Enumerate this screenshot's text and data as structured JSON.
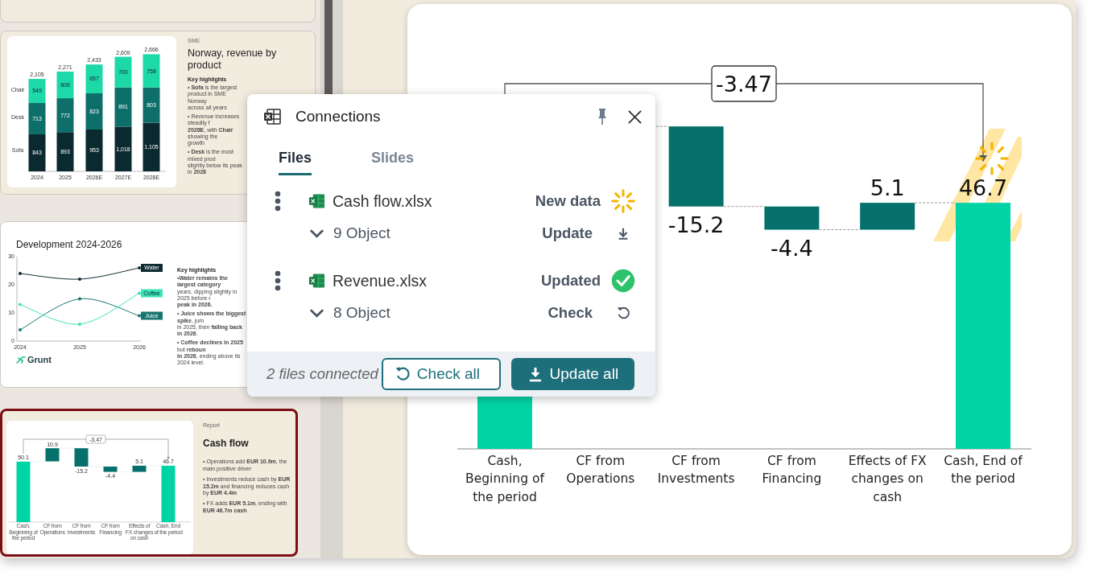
{
  "thumbnails": [
    {
      "kind": "stacked",
      "selected": false,
      "tag": "SME",
      "title": "Norway, revenue by product",
      "highlights_title": "Key highlights",
      "bullets": [
        {
          "lines": [
            "• **Sofa** is the largest product in SME Norway",
            "across all years"
          ]
        },
        {
          "lines": [
            "• Revenue increases steadily f",
            "**2028E**, with **Chair** showing the",
            "growth"
          ]
        },
        {
          "lines": [
            "• **Desk** is the most mixed prod",
            "slightly below its peak in **2028**"
          ]
        }
      ],
      "chart_data": {
        "type": "bar",
        "stacked": true,
        "data_labels": true,
        "categories": [
          "2024",
          "2025",
          "2026E",
          "2027E",
          "2028E"
        ],
        "series": [
          {
            "name": "Sofa",
            "color": "#0b2a2f",
            "values": [
              843,
              893,
              953,
              1018,
              1105
            ],
            "value_labels": [
              "843",
              "893",
              "953",
              "1,018",
              "1,105"
            ]
          },
          {
            "name": "Desk",
            "color": "#0e6e6a",
            "values": [
              713,
              772,
              823,
              891,
              803
            ],
            "value_labels": [
              "713",
              "772",
              "823",
              "891",
              "803"
            ]
          },
          {
            "name": "Chair",
            "color": "#1dd9a7",
            "values": [
              549,
              606,
              657,
              700,
              758
            ],
            "value_labels": [
              "549",
              "606",
              "657",
              "700",
              "758"
            ]
          }
        ],
        "annotations": [
          "2,105",
          "2,271",
          "2,433",
          "2,609",
          "2,666"
        ]
      }
    },
    {
      "kind": "line",
      "selected": false,
      "title": "Development 2024-2026",
      "highlights_title": "Key highlights",
      "bullets": [
        {
          "lines": [
            "•**Water remains the largest category**",
            "years, dipping slightly in 2025 before r",
            "**peak in 2026.**"
          ]
        },
        {
          "lines": [
            "• **Juice shows the biggest spike**, jum",
            "in 2025, then **falling back in 2026**."
          ]
        },
        {
          "lines": [
            "• **Coffee declines in 2025** but **reboun**",
            "**in 2026**, ending above its 2024 level."
          ]
        }
      ],
      "logo": "Grunt",
      "chart_data": {
        "type": "line",
        "x": [
          "2024",
          "2025",
          "2026"
        ],
        "ylim": [
          0,
          30
        ],
        "yticks": [
          0,
          10,
          20,
          30
        ],
        "series": [
          {
            "name": "Water",
            "color": "#0d2b30",
            "values": [
              24,
              22,
              26
            ]
          },
          {
            "name": "Juice",
            "color": "#16756e",
            "values": [
              4,
              15,
              9
            ]
          },
          {
            "name": "Coffee",
            "color": "#3de3b6",
            "values": [
              13,
              6,
              17
            ]
          }
        ]
      }
    },
    {
      "kind": "waterfall",
      "selected": true,
      "tag": "Report",
      "title": "Cash flow",
      "bullets": [
        {
          "text": "• Operations add **EUR 10.9m**, the main positive driver"
        },
        {
          "text": "• Investments reduce cash by **EUR 15.2m** and financing reduces cash by **EUR 4.4m**"
        },
        {
          "text": "• FX adds **EUR 5.1m**, ending with **EUR 46.7m cash**"
        }
      ],
      "waterfall": {
        "bracket": "-3.47",
        "bars": [
          {
            "label": "Cash, Beginning of the period",
            "value": "50.1",
            "kind": "total"
          },
          {
            "label": "CF from Operations",
            "value": "10.9",
            "kind": "delta"
          },
          {
            "label": "CF from Investments",
            "value": "-15.2",
            "kind": "delta"
          },
          {
            "label": "CF from Financing",
            "value": "-4.4",
            "kind": "delta"
          },
          {
            "label": "Effects of FX changes on cash",
            "value": "5.1",
            "kind": "delta"
          },
          {
            "label": "Cash, End of the period",
            "value": "46.7",
            "kind": "total"
          }
        ]
      }
    }
  ],
  "main_slide": {
    "new_data": true,
    "waterfall": {
      "bracket": "-3.47",
      "bars": [
        {
          "label": "Cash, Beginning of the period",
          "kind": "total"
        },
        {
          "label": "CF from Operations",
          "kind": "delta"
        },
        {
          "label": "CF from Investments",
          "value": "-15.2",
          "kind": "delta"
        },
        {
          "label": "CF from Financing",
          "value": "-4.4",
          "kind": "delta"
        },
        {
          "label": "Effects of FX changes on cash",
          "value": "5.1",
          "kind": "delta"
        },
        {
          "label": "Cash, End of the period",
          "value": "46.7",
          "kind": "total"
        }
      ]
    }
  },
  "connections": {
    "title": "Connections",
    "tabs": [
      {
        "label": "Files",
        "selected": true
      },
      {
        "label": "Slides",
        "selected": false
      }
    ],
    "files": [
      {
        "name": "Cash flow.xlsx",
        "status": {
          "text": "New data",
          "kind": "new"
        },
        "objects": "9 Object",
        "action": {
          "text": "Update",
          "kind": "update"
        }
      },
      {
        "name": "Revenue.xlsx",
        "status": {
          "text": "Updated",
          "kind": "updated"
        },
        "objects": "8 Object",
        "action": {
          "text": "Check",
          "kind": "check"
        }
      }
    ],
    "footer": "2 files connected",
    "buttons": [
      {
        "label": "Check all",
        "kind": "outline"
      },
      {
        "label": "Update all",
        "kind": "primary"
      }
    ]
  }
}
